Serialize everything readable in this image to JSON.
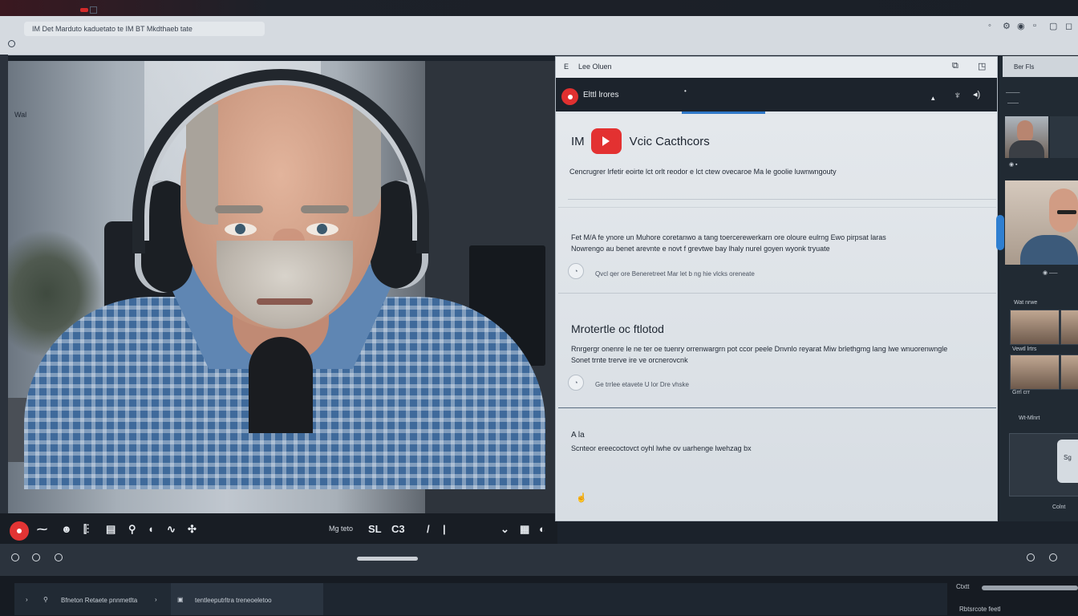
{
  "browser": {
    "tab_text": "IM Det Marduto    kaduetato te IM BT Mkdthaeb tate"
  },
  "left_panel": {
    "label": "Wal"
  },
  "video_controls": {
    "center_text": "Mg teto",
    "center_icons": [
      "SL",
      "C3",
      "/",
      "|"
    ]
  },
  "taskbar": {
    "tab1_text": "Bfneton Retaete pnnmetlta",
    "tab2_text": "tentleeputrltra treneoeletoo",
    "right_label": "Ctxtt",
    "right_bottom": "Rbtsrcote feetl"
  },
  "panel": {
    "top_label": "Lee Oluen",
    "top_prefix": "E",
    "header_label": "Elttl lrores",
    "title_prefix": "IM",
    "title": "Vcic Cacthcors",
    "section1": {
      "line1": "Cencrugrer lrfetir eoirte lct orlt reodor e lct ctew ovecaroe Ma le goolie luwnwngouty"
    },
    "section2": {
      "line1": "Fet M/A fe ynore un Muhore coretanwo a tang toercerewerkarn ore oloure eulrng Ewo pirpsat laras",
      "line2": "Nowrengo au benet arevnte e novt f grevtwe bay lhaly nurel goyen wyonk tryuate",
      "meta": "Qvcl qer ore Beneretreet Mar let b ng hie vlcks oreneate"
    },
    "section3": {
      "title": "Mrotertle oc ftlotod",
      "line1": "Rnrgergr onenre le ne ter oe tuenry orrenwargrn pot ccor peele Dnvnlo reyarat Miw brlethgmg lang lwe wnuorenwngle",
      "line2": "Sonet trnte trerve ire ve orcnerovcnk",
      "meta": "Ge trrlee etavete U lor Dre vhske"
    },
    "section4": {
      "title": "A la",
      "line1": "Scnteor ereecoctovct oyhl lwhe ov uarhenge lwehzag bx"
    }
  },
  "participants": {
    "top_label": "Ber   Fls",
    "label1": "Wat nrwe",
    "label2": "Vewtl lrtrs",
    "label3": "Grrl crr",
    "label4": "Wt-Mlnrt",
    "card_label": "Sg",
    "bottom_label": "Colnt"
  },
  "colors": {
    "record": "#e23434",
    "accent": "#2f78c8",
    "panel_bg": "#dfe4e9",
    "dark_bg": "#1b222b"
  }
}
